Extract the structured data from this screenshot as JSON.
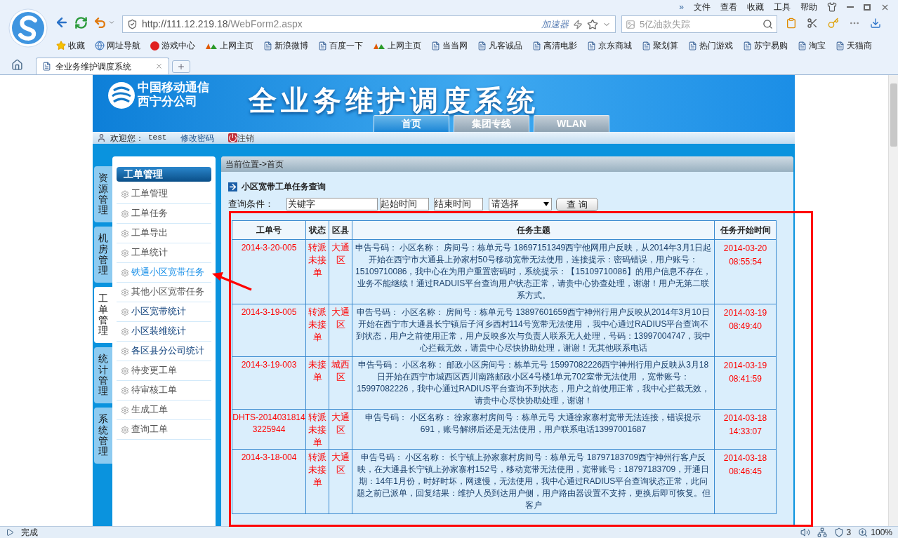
{
  "browser": {
    "more": "»",
    "menu": [
      "文件",
      "查看",
      "收藏",
      "工具",
      "帮助"
    ],
    "url_host": "http://111.12.219.18",
    "url_path": "/WebForm2.aspx",
    "accelerator": "加速器",
    "search_placeholder": "5亿油款失踪",
    "bookmarks": [
      {
        "kind": "star",
        "label": "收藏"
      },
      {
        "kind": "globe",
        "label": "网址导航"
      },
      {
        "kind": "game",
        "label": "游戏中心"
      },
      {
        "kind": "hao",
        "label": "上网主页"
      },
      {
        "kind": "page",
        "label": "新浪微博"
      },
      {
        "kind": "page",
        "label": "百度一下"
      },
      {
        "kind": "hao",
        "label": "上网主页"
      },
      {
        "kind": "page",
        "label": "当当网"
      },
      {
        "kind": "page",
        "label": "凡客诚品"
      },
      {
        "kind": "page",
        "label": "高清电影"
      },
      {
        "kind": "page",
        "label": "京东商城"
      },
      {
        "kind": "page",
        "label": "聚划算"
      },
      {
        "kind": "page",
        "label": "热门游戏"
      },
      {
        "kind": "page",
        "label": "苏宁易购"
      },
      {
        "kind": "page",
        "label": "淘宝"
      },
      {
        "kind": "page",
        "label": "天猫商"
      }
    ],
    "tab_title": "全业务维护调度系统",
    "status": "完成",
    "badge_count": "3",
    "zoom": "100%"
  },
  "header": {
    "logo_lines": [
      "中国移动通信",
      "西宁分公司"
    ],
    "system_title": "全业务维护调度系统",
    "nav_tabs": [
      {
        "label": "首页",
        "selected": true
      },
      {
        "label": "集团专线",
        "selected": false
      },
      {
        "label": "WLAN",
        "selected": false
      }
    ],
    "welcome": "欢迎您：",
    "user": "test",
    "change_password": "修改密码",
    "logout": "注销"
  },
  "side_tabs": [
    {
      "label": "资源管理",
      "selected": false
    },
    {
      "label": "机房管理",
      "selected": false
    },
    {
      "label": "工单管理",
      "selected": true
    },
    {
      "label": "统计管理",
      "selected": false
    },
    {
      "label": "系统管理",
      "selected": false
    }
  ],
  "sidebar": {
    "title": "工单管理",
    "items": [
      {
        "label": "工单管理",
        "selected": false,
        "visited": false
      },
      {
        "label": "工单任务",
        "selected": false,
        "visited": false
      },
      {
        "label": "工单导出",
        "selected": false,
        "visited": false
      },
      {
        "label": "工单统计",
        "selected": false,
        "visited": false
      },
      {
        "label": "铁通小区宽带任务",
        "selected": true,
        "visited": false
      },
      {
        "label": "其他小区宽带任务",
        "selected": false,
        "visited": false
      },
      {
        "label": "小区宽带统计",
        "selected": false,
        "visited": true
      },
      {
        "label": "小区装维统计",
        "selected": false,
        "visited": true
      },
      {
        "label": "各区县分公司统计",
        "selected": false,
        "visited": true
      },
      {
        "label": "待变更工单",
        "selected": false,
        "visited": false
      },
      {
        "label": "待审核工单",
        "selected": false,
        "visited": false
      },
      {
        "label": "生成工单",
        "selected": false,
        "visited": false
      },
      {
        "label": "查询工单",
        "selected": false,
        "visited": false
      }
    ]
  },
  "main": {
    "breadcrumb": "当前位置->首页",
    "section_title": "小区宽带工单任务查询",
    "query_label": "查询条件：",
    "keyword_value": "关键字",
    "start_value": "起始时间",
    "end_value": "结束时间",
    "select_value": "请选择",
    "query_button": "查 询",
    "table": {
      "columns": [
        "工单号",
        "状态",
        "区县",
        "任务主题",
        "任务开始时间"
      ],
      "rows": [
        {
          "id": "2014-3-20-005",
          "status": "转派未接单",
          "district": "大通区",
          "subject": "申告号码： 小区名称： 房间号：栋单元号 18697151349西宁他网用户反映，从2014年3月1日起开始在西宁市大通县上孙家村50号移动宽带无法使用，连接提示：密码错误，用户账号：15109710086，我中心在为用户重置密码时，系统提示：【15109710086】的用户信息不存在，业务不能继续！通过RADUIS平台查询用户状态正常，请贵中心协查处理，谢谢！用户无第二联系方式。",
          "start_date": "2014-03-20",
          "start_time": "08:55:54"
        },
        {
          "id": "2014-3-19-005",
          "status": "转派未接单",
          "district": "大通区",
          "subject": "申告号码： 小区名称： 房间号：栋单元号 13897601659西宁神州行用户反映从2014年3月10日开始在西宁市大通县长宁镇后子河乡西村114号宽带无法使用 ，我中心通过RADIUS平台查询不到状态，用户之前使用正常，用户反映多次与负责人联系无人处理，号码：13997004747，我中心拦截无效，请贵中心尽快协助处理，谢谢！无其他联系电话",
          "start_date": "2014-03-19",
          "start_time": "08:49:40"
        },
        {
          "id": "2014-3-19-003",
          "status": "未接单",
          "district": "城西区",
          "subject": "申告号码： 小区名称： 邮政小区房间号：栋单元号 15997082226西宁神州行用户反映从3月18日开始在西宁市城西区西川南路邮政小区4号楼1单元702室带无法使用 ，宽带账号：15997082226，我中心通过RADIUS平台查询不到状态，用户之前使用正常，我中心拦截无效，请贵中心尽快协助处理，谢谢！",
          "start_date": "2014-03-19",
          "start_time": "08:41:59"
        },
        {
          "id": "DHTS-20140318143225944",
          "status": "转派未接单",
          "district": "大通区",
          "subject": "申告号码： 小区名称： 徐家寨村房间号：栋单元号 大通徐家寨村宽带无法连接，错误提示691，账号解绑后还是无法使用，用户联系电话13997001687",
          "start_date": "2014-03-18",
          "start_time": "14:33:07"
        },
        {
          "id": "2014-3-18-004",
          "status": "转派未接单",
          "district": "大通区",
          "subject": "申告号码： 小区名称： 长宁镇上孙家寨村房间号：栋单元号 18797183709西宁神州行客户反映，在大通县长宁镇上孙家寨村152号，移动宽带无法使用，宽带账号：18797183709，开通日期：14年1月份，时好时坏，网速慢，无法使用，我中心通过RADIUS平台查询状态正常，此问题之前已派单，回复结果：维护人员到达用户侧，用户路由器设置不支持，更换后即可恢复。但客户",
          "start_date": "2014-03-18",
          "start_time": "08:46:45"
        }
      ]
    }
  }
}
